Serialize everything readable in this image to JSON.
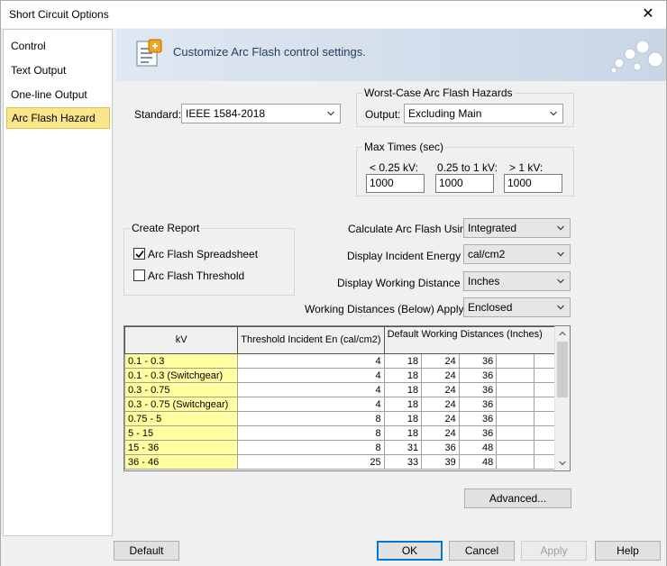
{
  "window": {
    "title": "Short Circuit Options",
    "close_glyph": "✕"
  },
  "sidebar": {
    "items": [
      {
        "label": "Control",
        "active": false
      },
      {
        "label": "Text Output",
        "active": false
      },
      {
        "label": "One-line Output",
        "active": false
      },
      {
        "label": "Arc Flash Hazard",
        "active": true
      }
    ]
  },
  "banner": {
    "text": "Customize Arc Flash control settings.",
    "icon": "settings-document-icon",
    "decoration": "bubbles-logo-icon"
  },
  "standard": {
    "label": "Standard:",
    "value": "IEEE 1584-2018"
  },
  "worst_case": {
    "legend": "Worst-Case Arc Flash Hazards",
    "output_label": "Output:",
    "output_value": "Excluding Main"
  },
  "max_times": {
    "legend": "Max Times (sec)",
    "col1_label": "< 0.25 kV:",
    "col2_label": "0.25 to 1 kV:",
    "col3_label": "> 1 kV:",
    "col1_value": "1000",
    "col2_value": "1000",
    "col3_value": "1000"
  },
  "create_report": {
    "legend": "Create Report",
    "spreadsheet_label": "Arc Flash Spreadsheet",
    "spreadsheet_checked": true,
    "threshold_label": "Arc Flash Threshold",
    "threshold_checked": false
  },
  "settings": {
    "calc_label": "Calculate Arc Flash Using:",
    "calc_value": "Integrated",
    "energy_label": "Display Incident Energy in:",
    "energy_value": "cal/cm2",
    "distance_label": "Display Working Distance in:",
    "distance_value": "Inches",
    "apply_label": "Working Distances (Below) Apply to:",
    "apply_value": "Enclosed"
  },
  "table": {
    "headers": {
      "kv": "kV",
      "threshold": "Threshold Incident En (cal/cm2)",
      "distances": "Default Working Distances (Inches)"
    },
    "rows": [
      [
        "0.1 - 0.3",
        "4",
        "18",
        "24",
        "36",
        "",
        ""
      ],
      [
        "0.1 - 0.3 (Switchgear)",
        "4",
        "18",
        "24",
        "36",
        "",
        ""
      ],
      [
        "0.3 - 0.75",
        "4",
        "18",
        "24",
        "36",
        "",
        ""
      ],
      [
        "0.3 - 0.75 (Switchgear)",
        "4",
        "18",
        "24",
        "36",
        "",
        ""
      ],
      [
        "0.75 - 5",
        "8",
        "18",
        "24",
        "36",
        "",
        ""
      ],
      [
        "5 - 15",
        "8",
        "18",
        "24",
        "36",
        "",
        ""
      ],
      [
        "15 - 36",
        "8",
        "31",
        "36",
        "48",
        "",
        ""
      ],
      [
        "36 - 46",
        "25",
        "33",
        "39",
        "48",
        "",
        ""
      ]
    ]
  },
  "buttons": {
    "advanced": "Advanced...",
    "default": "Default",
    "ok": "OK",
    "cancel": "Cancel",
    "apply": "Apply",
    "help": "Help"
  },
  "colors": {
    "active_nav": "#fbe58a",
    "kv_cell": "#ffff9f",
    "banner_text": "#1f3f63",
    "focus_border": "#0078d7"
  }
}
